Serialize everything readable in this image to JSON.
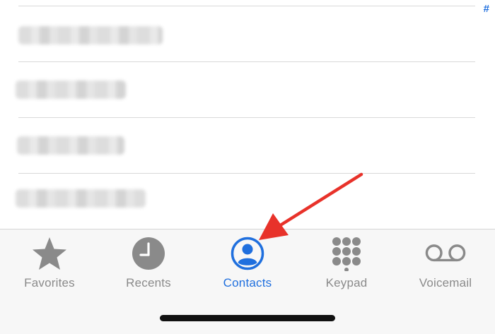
{
  "index_bar": {
    "hash": "#"
  },
  "contacts": [
    {
      "name": ""
    },
    {
      "name": ""
    },
    {
      "name": ""
    },
    {
      "name": ""
    }
  ],
  "tabs": [
    {
      "label": "Favorites",
      "icon": "star-icon",
      "active": false
    },
    {
      "label": "Recents",
      "icon": "clock-icon",
      "active": false
    },
    {
      "label": "Contacts",
      "icon": "person-circle-icon",
      "active": true
    },
    {
      "label": "Keypad",
      "icon": "keypad-icon",
      "active": false
    },
    {
      "label": "Voicemail",
      "icon": "voicemail-icon",
      "active": false
    }
  ],
  "colors": {
    "accent": "#1f6fde",
    "inactive": "#8a8a8a",
    "annotation": "#e8322a"
  }
}
